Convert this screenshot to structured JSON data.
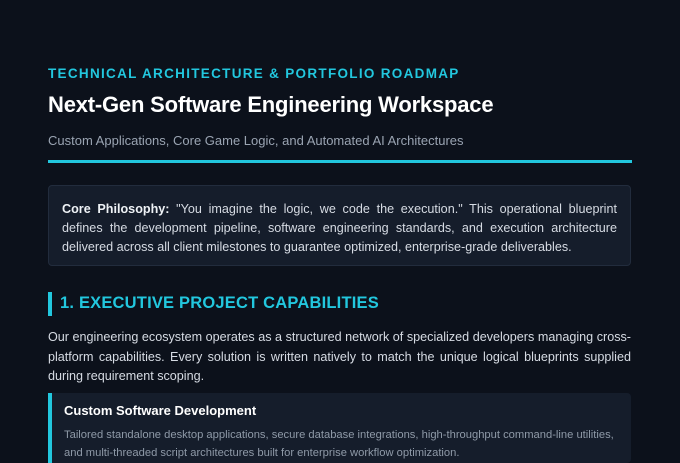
{
  "header": {
    "eyebrow": "TECHNICAL ARCHITECTURE & PORTFOLIO ROADMAP",
    "title": "Next-Gen Software Engineering Workspace",
    "subtitle": "Custom Applications, Core Game Logic, and Automated AI Architectures"
  },
  "philosophy": {
    "lead": "Core Philosophy:",
    "body": " \"You imagine the logic, we code the execution.\" This operational blueprint defines the development pipeline, software engineering standards, and execution architecture delivered across all client milestones to guarantee optimized, enterprise-grade deliverables."
  },
  "section1": {
    "heading": "1. EXECUTIVE PROJECT CAPABILITIES",
    "intro": "Our engineering ecosystem operates as a structured network of specialized developers managing cross-platform capabilities. Every solution is written natively to match the unique logical blueprints supplied during requirement scoping.",
    "cards": [
      {
        "title": "Custom Software Development",
        "description": "Tailored standalone desktop applications, secure database integrations, high-throughput command-line utilities, and multi-threaded script architectures built for enterprise workflow optimization."
      }
    ]
  },
  "colors": {
    "accent": "#22c7de",
    "background": "#0c111b",
    "panel": "#151d2b"
  }
}
